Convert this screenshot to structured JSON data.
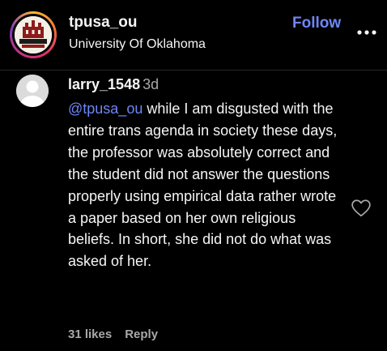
{
  "post_header": {
    "username": "tpusa_ou",
    "subtitle": "University Of Oklahoma",
    "follow_label": "Follow",
    "avatar_icon": "tpusa-ou-logo-icon",
    "more_icon": "more-options-icon"
  },
  "comment": {
    "username": "larry_1548",
    "time": "3d",
    "mention": "@tpusa_ou",
    "text": " while I am disgusted with the entire trans agenda in society these days, the professor was absolutely correct and the student did not answer the questions properly using empirical data rather wrote a paper based on her own religious beliefs. In short, she did not do what was asked of her.",
    "likes": "31 likes",
    "reply_label": "Reply",
    "avatar_icon": "default-user-avatar-icon",
    "like_icon": "heart-outline-icon"
  },
  "colors": {
    "background": "#000000",
    "text": "#f5f5f5",
    "muted": "#a8a8a8",
    "accent": "#6f86f7"
  }
}
